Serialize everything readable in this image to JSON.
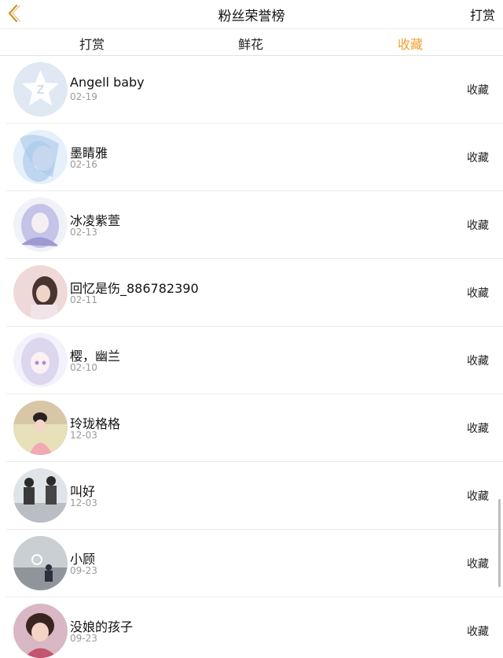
{
  "nav": {
    "title": "粉丝荣誉榜",
    "right_label": "打赏",
    "back_icon": "chevron-left-icon",
    "back_color": "#c8962a"
  },
  "tabs": [
    {
      "label": "打赏",
      "active": false
    },
    {
      "label": "鲜花",
      "active": false
    },
    {
      "label": "收藏",
      "active": true
    }
  ],
  "accent_color": "#f0a030",
  "list": [
    {
      "name": "Angell baby",
      "date": "02-19",
      "action": "收藏",
      "avatar": "default-avatar-icon"
    },
    {
      "name": "墨睛雅",
      "date": "02-16",
      "action": "收藏",
      "avatar": "anime-avatar"
    },
    {
      "name": "冰凌紫萱",
      "date": "02-13",
      "action": "收藏",
      "avatar": "anime-avatar"
    },
    {
      "name": "回忆是伤_886782390",
      "date": "02-11",
      "action": "收藏",
      "avatar": "photo-avatar"
    },
    {
      "name": "樱，幽兰",
      "date": "02-10",
      "action": "收藏",
      "avatar": "anime-avatar"
    },
    {
      "name": "玲珑格格",
      "date": "12-03",
      "action": "收藏",
      "avatar": "photo-avatar"
    },
    {
      "name": "叫好",
      "date": "12-03",
      "action": "收藏",
      "avatar": "photo-avatar"
    },
    {
      "name": "小顾",
      "date": "09-23",
      "action": "收藏",
      "avatar": "photo-avatar"
    },
    {
      "name": "没娘的孩子",
      "date": "09-23",
      "action": "收藏",
      "avatar": "photo-avatar"
    }
  ]
}
